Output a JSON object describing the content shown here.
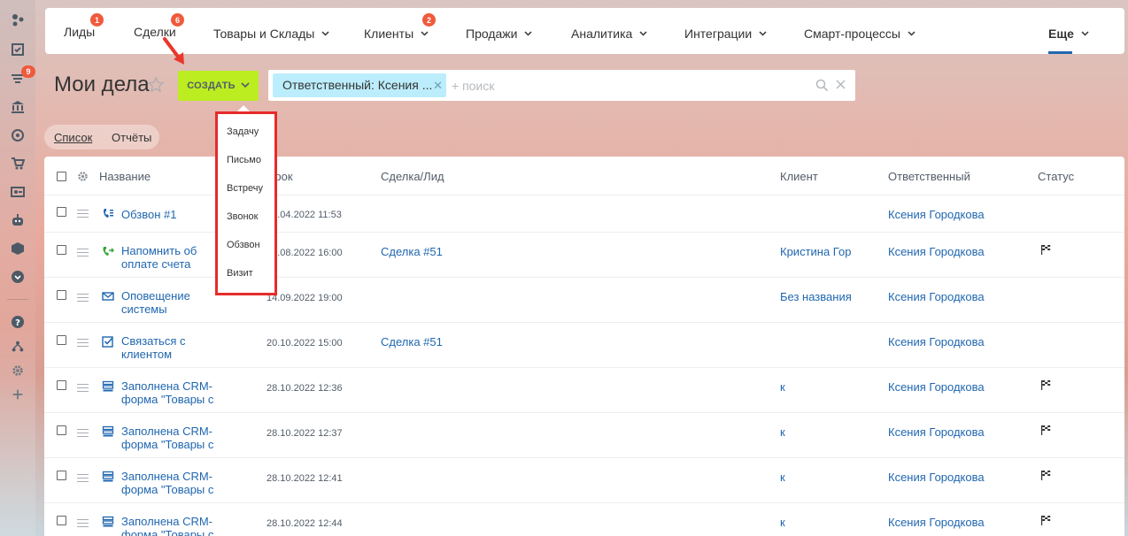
{
  "nav": {
    "items": [
      {
        "label": "Лиды",
        "badge": "1"
      },
      {
        "label": "Сделки",
        "badge": "6"
      },
      {
        "label": "Товары и Склады"
      },
      {
        "label": "Клиенты",
        "badge": "2"
      },
      {
        "label": "Продажи"
      },
      {
        "label": "Аналитика"
      },
      {
        "label": "Интеграции"
      },
      {
        "label": "Смарт-процессы"
      },
      {
        "label": "Еще"
      }
    ]
  },
  "sidebar": {
    "badge": "9"
  },
  "page": {
    "title": "Мои дела",
    "create_label": "СОЗДАТЬ"
  },
  "search": {
    "filter_chip": "Ответственный: Ксения ...",
    "placeholder": "+ поиск"
  },
  "view_tabs": [
    "Список",
    "Отчёты"
  ],
  "create_menu": [
    "Задачу",
    "Письмо",
    "Встречу",
    "Звонок",
    "Обзвон",
    "Визит"
  ],
  "table": {
    "columns": [
      "Название",
      "Срок",
      "Сделка/Лид",
      "Клиент",
      "Ответственный",
      "Статус"
    ],
    "rows": [
      {
        "type": "call-list",
        "name": "Обзвон #1",
        "date": "14.04.2022 11:53",
        "deal": "",
        "client": "",
        "owner": "Ксения Городкова",
        "flag": false
      },
      {
        "type": "outgoing-call",
        "name": "Напомнить об оплате счета",
        "date": "16.08.2022 16:00",
        "deal": "Сделка #51",
        "client": "Кристина Гор",
        "owner": "Ксения Городкова",
        "flag": true
      },
      {
        "type": "email",
        "name": "Оповещение системы",
        "date": "14.09.2022 19:00",
        "deal": "",
        "client": "Без названия",
        "owner": "Ксения Городкова",
        "flag": false
      },
      {
        "type": "task",
        "name": "Связаться с клиентом",
        "date": "20.10.2022 15:00",
        "deal": "Сделка #51",
        "client": "",
        "owner": "Ксения Городкова",
        "flag": false
      },
      {
        "type": "crm-form",
        "name": "Заполнена CRM-форма \"Товары с",
        "date": "28.10.2022 12:36",
        "deal": "",
        "client": "к",
        "owner": "Ксения Городкова",
        "flag": true
      },
      {
        "type": "crm-form",
        "name": "Заполнена CRM-форма \"Товары с",
        "date": "28.10.2022 12:37",
        "deal": "",
        "client": "к",
        "owner": "Ксения Городкова",
        "flag": true
      },
      {
        "type": "crm-form",
        "name": "Заполнена CRM-форма \"Товары с",
        "date": "28.10.2022 12:41",
        "deal": "",
        "client": "к",
        "owner": "Ксения Городкова",
        "flag": true
      },
      {
        "type": "crm-form",
        "name": "Заполнена CRM-форма \"Товары с",
        "date": "28.10.2022 12:44",
        "deal": "",
        "client": "к",
        "owner": "Ксения Городкова",
        "flag": true
      }
    ]
  }
}
